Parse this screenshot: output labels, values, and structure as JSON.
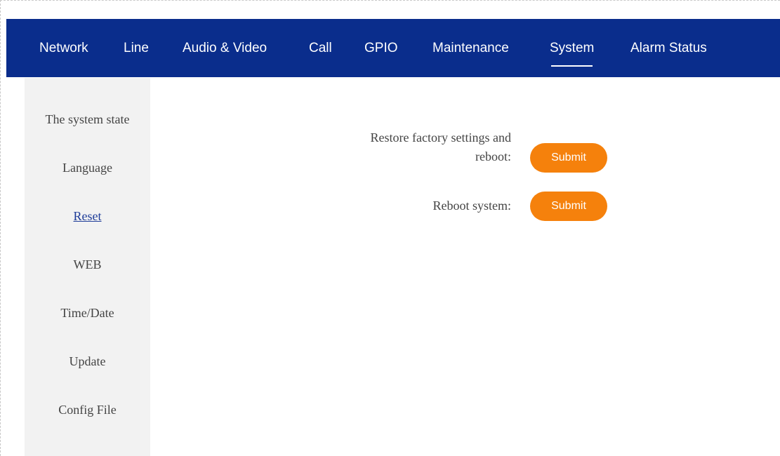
{
  "topnav": {
    "items": [
      {
        "label": "Network"
      },
      {
        "label": "Line"
      },
      {
        "label": "Audio & Video"
      },
      {
        "label": "Call"
      },
      {
        "label": "GPIO"
      },
      {
        "label": "Maintenance"
      },
      {
        "label": "System",
        "active": true
      },
      {
        "label": "Alarm Status"
      }
    ],
    "colors": {
      "background": "#0a2d8c",
      "text": "#ffffff"
    }
  },
  "sidebar": {
    "items": [
      {
        "label": "The system state"
      },
      {
        "label": "Language"
      },
      {
        "label": "Reset",
        "active": true
      },
      {
        "label": "WEB"
      },
      {
        "label": "Time/Date"
      },
      {
        "label": "Update"
      },
      {
        "label": "Config File"
      }
    ]
  },
  "reset": {
    "factory_label_line1": "Restore factory settings and",
    "factory_label_line2": "reboot:",
    "factory_button": "Submit",
    "reboot_label": "Reboot system:",
    "reboot_button": "Submit",
    "button_color": "#f5810c"
  }
}
